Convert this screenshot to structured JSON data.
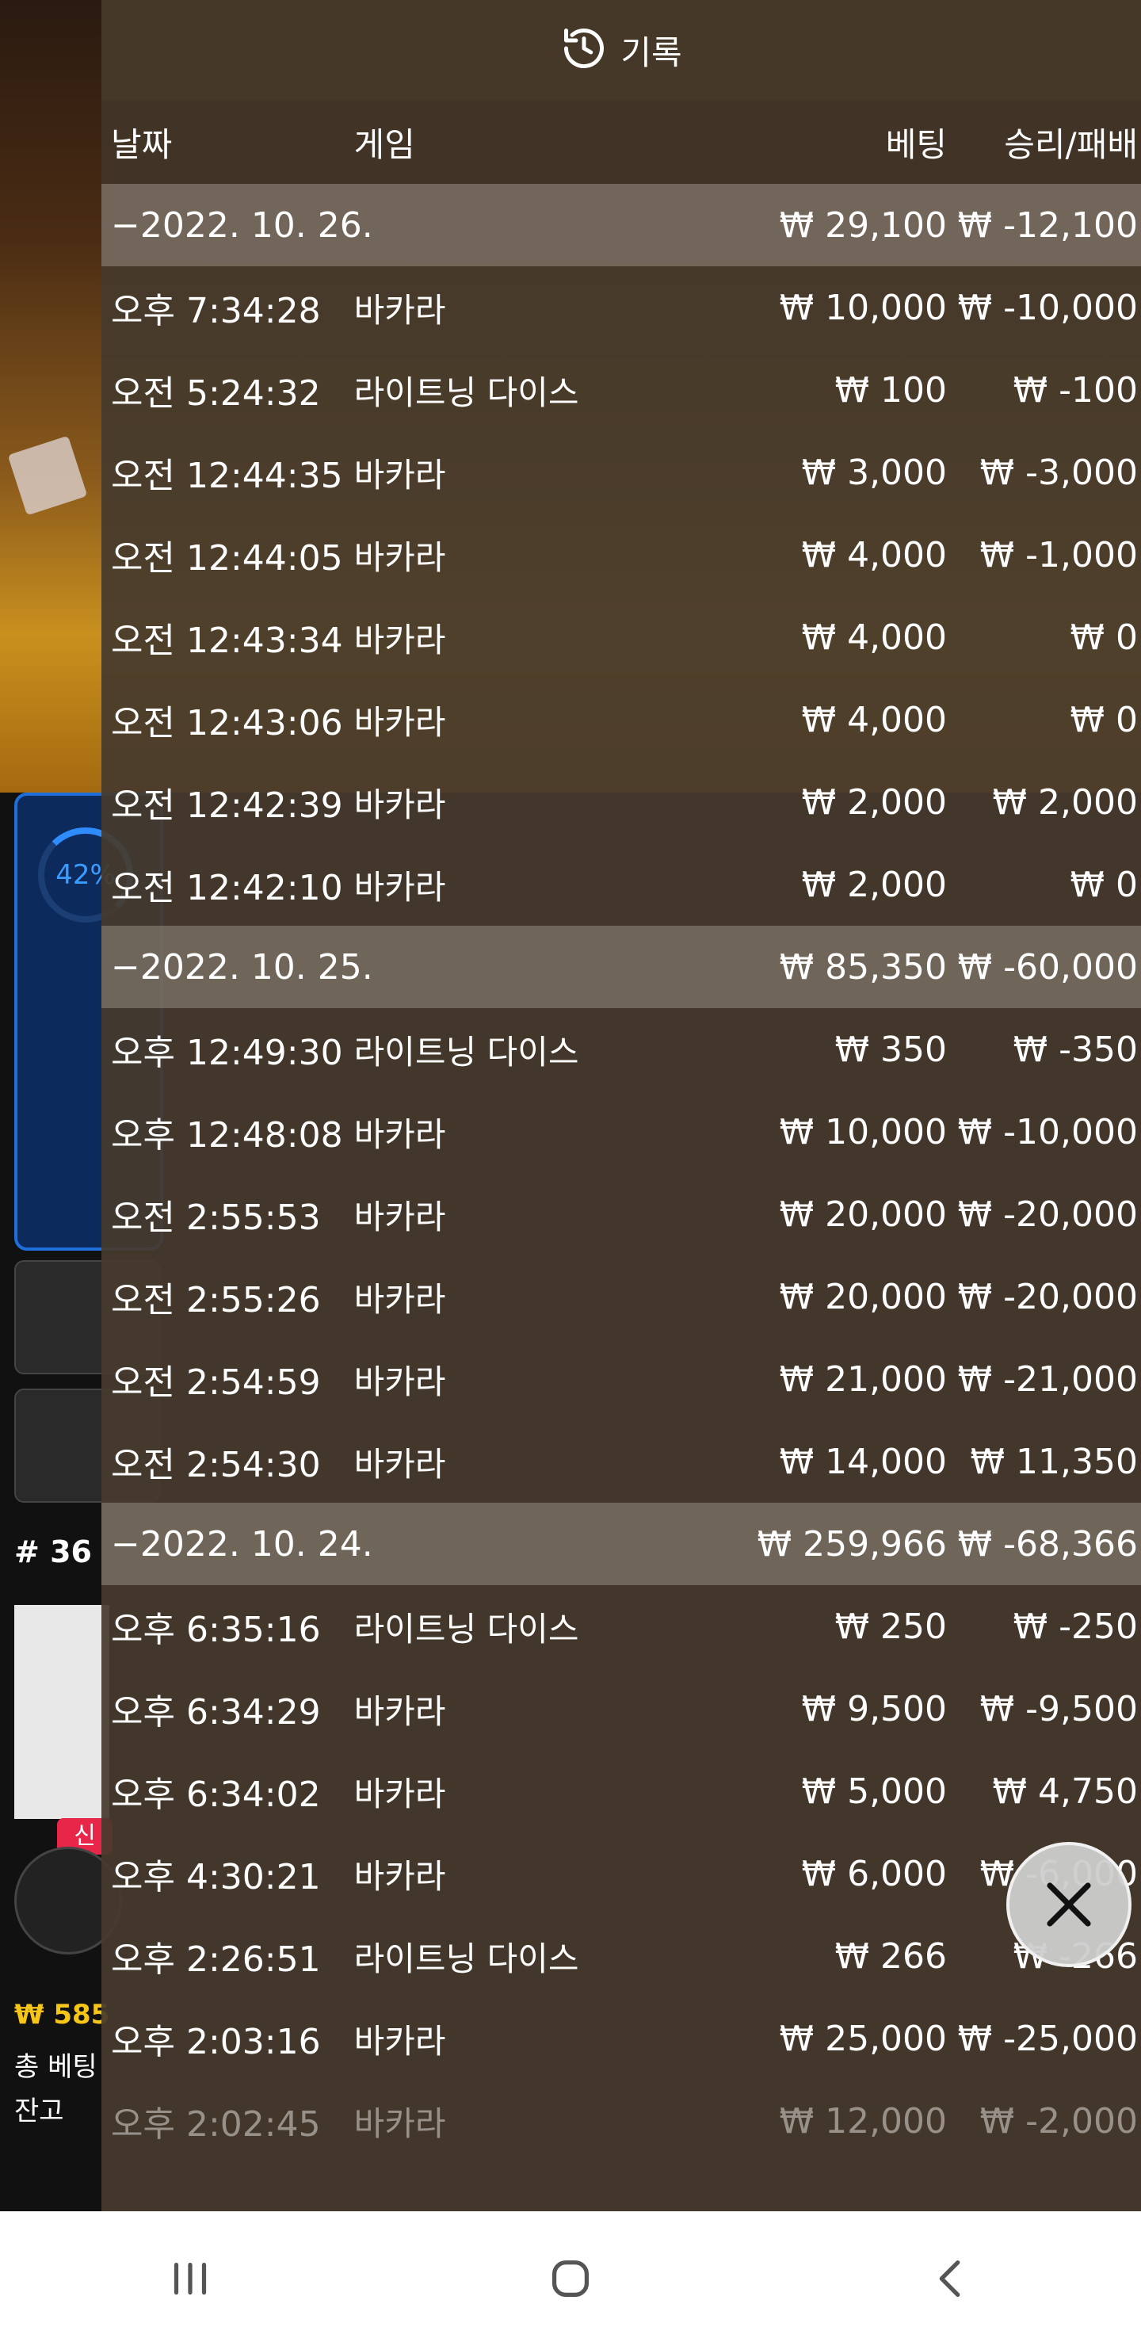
{
  "header": {
    "title": "기록",
    "icon": "history-icon"
  },
  "columns": {
    "date": "날짜",
    "game": "게임",
    "bet": "베팅",
    "result": "승리/패배"
  },
  "groups": [
    {
      "date": "−2022. 10. 26.",
      "bet": "₩ 29,100",
      "result": "₩ -12,100",
      "rows": [
        {
          "time": "오후 7:34:28",
          "game": "바카라",
          "bet": "₩ 10,000",
          "result": "₩ -10,000"
        },
        {
          "time": "오전 5:24:32",
          "game": "라이트닝 다이스",
          "bet": "₩ 100",
          "result": "₩ -100"
        },
        {
          "time": "오전 12:44:35",
          "game": "바카라",
          "bet": "₩ 3,000",
          "result": "₩ -3,000"
        },
        {
          "time": "오전 12:44:05",
          "game": "바카라",
          "bet": "₩ 4,000",
          "result": "₩ -1,000"
        },
        {
          "time": "오전 12:43:34",
          "game": "바카라",
          "bet": "₩ 4,000",
          "result": "₩ 0"
        },
        {
          "time": "오전 12:43:06",
          "game": "바카라",
          "bet": "₩ 4,000",
          "result": "₩ 0"
        },
        {
          "time": "오전 12:42:39",
          "game": "바카라",
          "bet": "₩ 2,000",
          "result": "₩ 2,000"
        },
        {
          "time": "오전 12:42:10",
          "game": "바카라",
          "bet": "₩ 2,000",
          "result": "₩ 0"
        }
      ]
    },
    {
      "date": "−2022. 10. 25.",
      "bet": "₩ 85,350",
      "result": "₩ -60,000",
      "rows": [
        {
          "time": "오후 12:49:30",
          "game": "라이트닝 다이스",
          "bet": "₩ 350",
          "result": "₩ -350"
        },
        {
          "time": "오후 12:48:08",
          "game": "바카라",
          "bet": "₩ 10,000",
          "result": "₩ -10,000"
        },
        {
          "time": "오전 2:55:53",
          "game": "바카라",
          "bet": "₩ 20,000",
          "result": "₩ -20,000"
        },
        {
          "time": "오전 2:55:26",
          "game": "바카라",
          "bet": "₩ 20,000",
          "result": "₩ -20,000"
        },
        {
          "time": "오전 2:54:59",
          "game": "바카라",
          "bet": "₩ 21,000",
          "result": "₩ -21,000"
        },
        {
          "time": "오전 2:54:30",
          "game": "바카라",
          "bet": "₩ 14,000",
          "result": "₩ 11,350"
        }
      ]
    },
    {
      "date": "−2022. 10. 24.",
      "bet": "₩ 259,966",
      "result": "₩ -68,366",
      "rows": [
        {
          "time": "오후 6:35:16",
          "game": "라이트닝 다이스",
          "bet": "₩ 250",
          "result": "₩ -250"
        },
        {
          "time": "오후 6:34:29",
          "game": "바카라",
          "bet": "₩ 9,500",
          "result": "₩ -9,500"
        },
        {
          "time": "오후 6:34:02",
          "game": "바카라",
          "bet": "₩ 5,000",
          "result": "₩ 4,750"
        },
        {
          "time": "오후 4:30:21",
          "game": "바카라",
          "bet": "₩ 6,000",
          "result": "₩ -6,000"
        },
        {
          "time": "오후 2:26:51",
          "game": "라이트닝 다이스",
          "bet": "₩ 266",
          "result": "₩ -266"
        },
        {
          "time": "오후 2:03:16",
          "game": "바카라",
          "bet": "₩ 25,000",
          "result": "₩ -25,000"
        },
        {
          "time": "오후 2:02:45",
          "game": "바카라",
          "bet": "₩ 12,000",
          "result": "₩ -2,000"
        }
      ]
    }
  ],
  "background": {
    "progress": "42%",
    "round": "# 36",
    "new_badge": "신",
    "balance": "₩ 585",
    "total_bet": "총 베팅",
    "remain": "잔고"
  },
  "navbar": {
    "recent": "recent-apps-icon",
    "home": "home-icon",
    "back": "back-icon"
  }
}
